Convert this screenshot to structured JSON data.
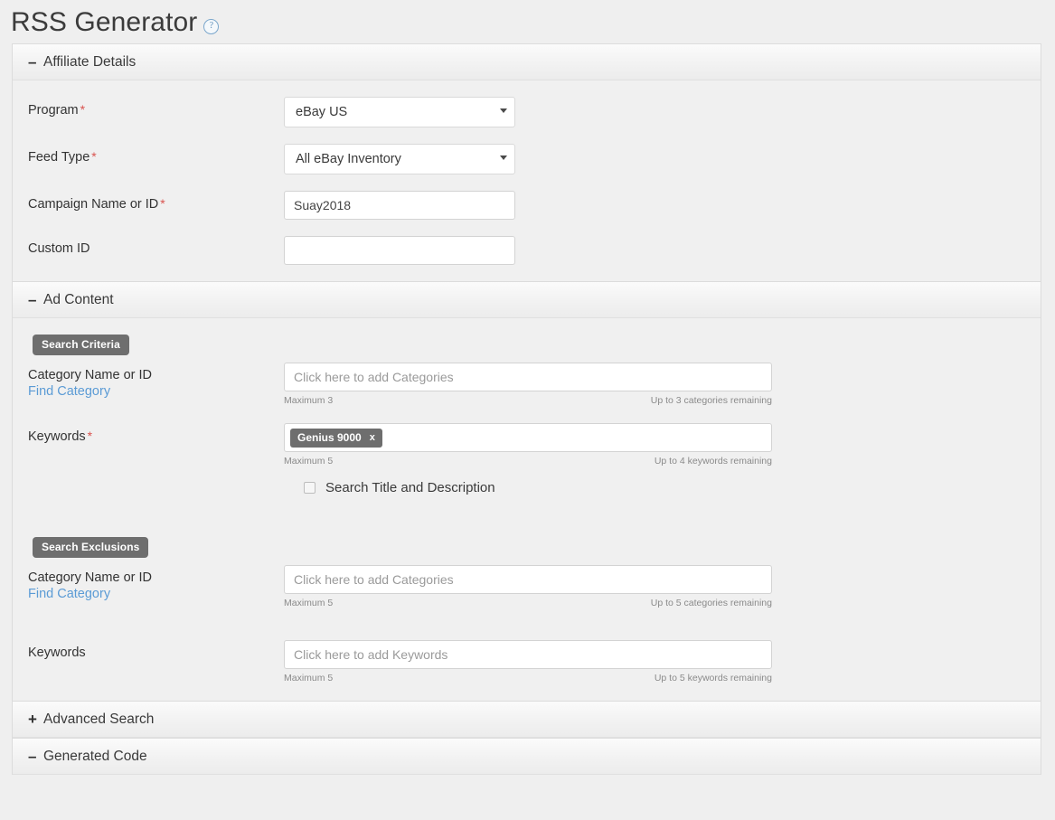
{
  "page": {
    "title": "RSS Generator",
    "help_icon": "question-mark-circle-icon",
    "help_label": "?"
  },
  "sections": {
    "affiliate_details": {
      "toggle": "–",
      "title": "Affiliate Details",
      "fields": {
        "program": {
          "label": "Program",
          "required": "*",
          "value": "eBay US",
          "type": "select"
        },
        "feed_type": {
          "label": "Feed Type",
          "required": "*",
          "value": "All eBay Inventory",
          "type": "select"
        },
        "campaign": {
          "label": "Campaign Name or ID",
          "required": "*",
          "value": "Suay2018",
          "placeholder": ""
        },
        "custom_id": {
          "label": "Custom ID",
          "required": "",
          "value": "",
          "placeholder": ""
        }
      }
    },
    "ad_content": {
      "toggle": "–",
      "title": "Ad Content",
      "search_criteria": {
        "badge": "Search Criteria",
        "category": {
          "label": "Category Name or ID",
          "link": "Find Category",
          "placeholder": "Click here to add Categories",
          "value": "",
          "maximum": "Maximum 3",
          "remaining": "Up to 3 categories remaining"
        },
        "keywords": {
          "label": "Keywords",
          "required": "*",
          "placeholder": "",
          "chips": [
            {
              "text": "Genius 9000",
              "remove": "x"
            }
          ],
          "maximum": "Maximum 5",
          "remaining": "Up to 4 keywords remaining"
        },
        "search_title_desc": {
          "label": "Search Title and Description",
          "checked": false
        }
      },
      "search_exclusions": {
        "badge": "Search Exclusions",
        "category": {
          "label": "Category Name or ID",
          "link": "Find Category",
          "placeholder": "Click here to add Categories",
          "value": "",
          "maximum": "Maximum 5",
          "remaining": "Up to 5 categories remaining"
        },
        "keywords": {
          "label": "Keywords",
          "required": "",
          "placeholder": "Click here to add Keywords",
          "value": "",
          "maximum": "Maximum 5",
          "remaining": "Up to 5 keywords remaining"
        }
      }
    },
    "advanced_search": {
      "toggle": "+",
      "title": "Advanced Search"
    },
    "generated_code": {
      "toggle": "–",
      "title": "Generated Code"
    }
  },
  "colors": {
    "page_bg": "#efefef",
    "panel_bg": "#f0f0f0",
    "badge_bg": "#6e6e6e",
    "link_blue": "#5b9bd5",
    "required_red": "#d9534f",
    "help_blue": "#5b8db8"
  }
}
